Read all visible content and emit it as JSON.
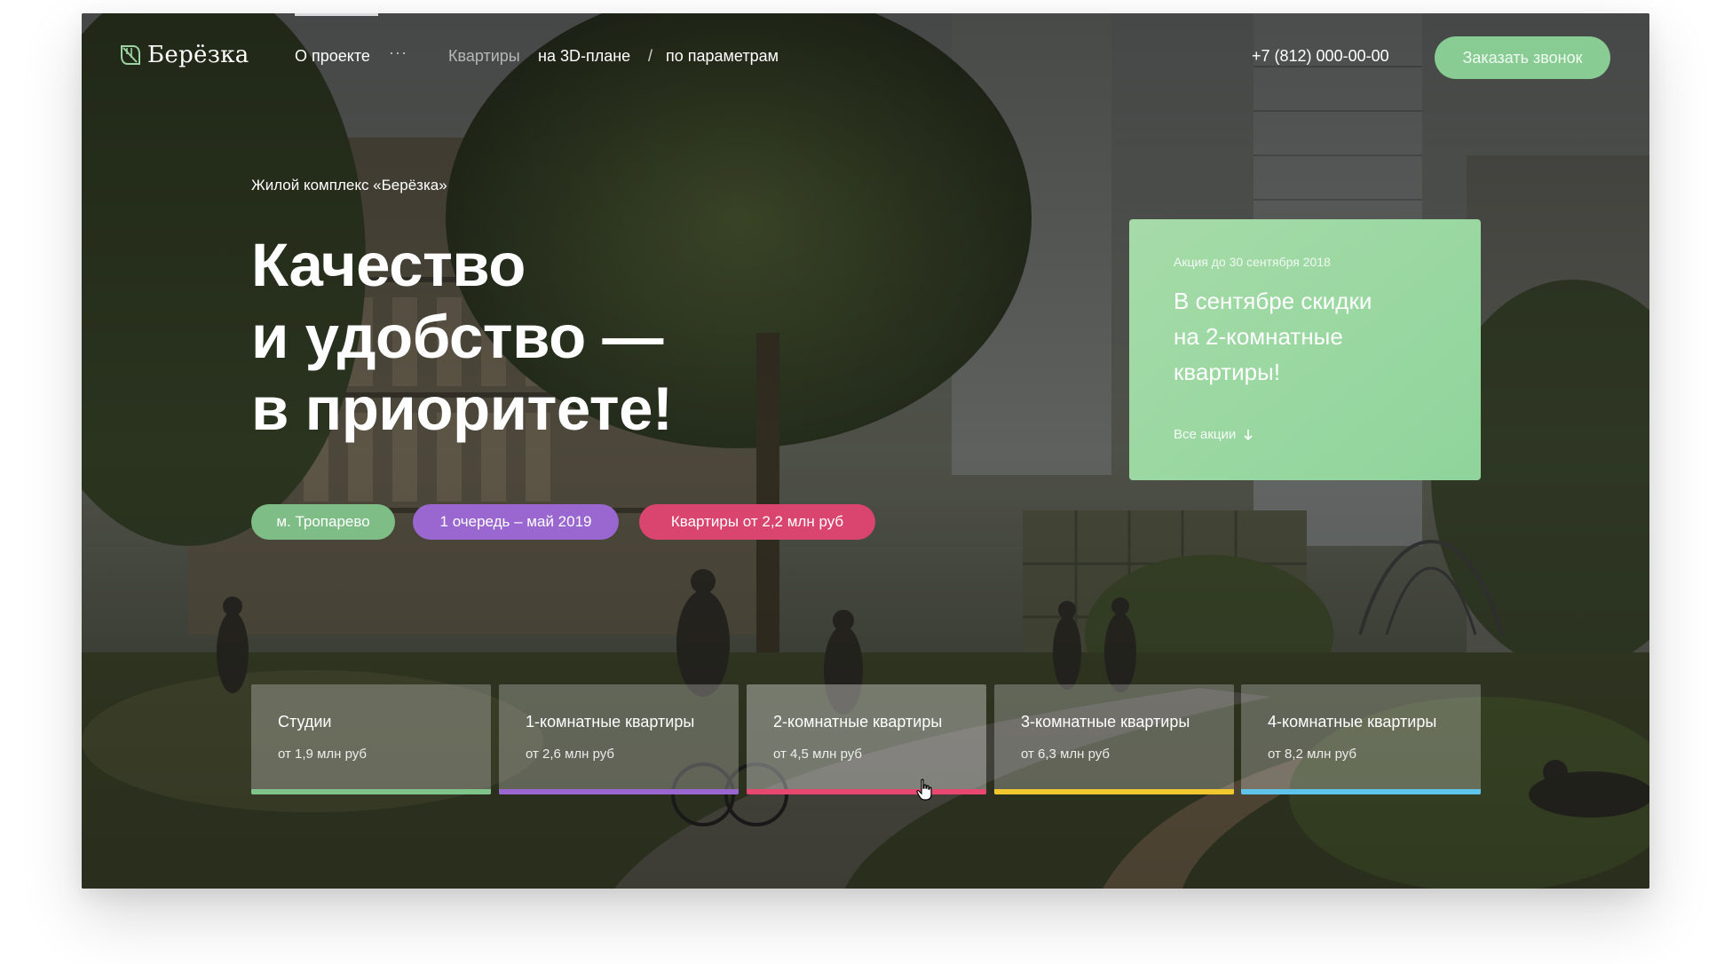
{
  "header": {
    "logo_text": "Берёзка",
    "logo_icon": "leaf-icon",
    "nav_about": "О проекте",
    "nav_more": "···",
    "nav_apartments": "Квартиры",
    "nav_3d": "на 3D-плане",
    "nav_separator": "/",
    "nav_params": "по параметрам",
    "phone": "+7 (812) 000-00-00",
    "callback_label": "Заказать звонок"
  },
  "hero": {
    "subtitle": "Жилой комплекс «Берёзка»",
    "headline_lines": [
      "Качество",
      "и удобство —",
      "в приоритете!"
    ],
    "chips": [
      {
        "label": "м. Тропарево",
        "color": "#7fbd86"
      },
      {
        "label": "1 очередь – май 2019",
        "color": "#9a66cf"
      },
      {
        "label": "Квартиры от 2,2 млн руб",
        "color": "#d9456f"
      }
    ]
  },
  "promo": {
    "date": "Акция до 30 сентября 2018",
    "title_lines": [
      "В сентябре скидки",
      "на 2-комнатные",
      "квартиры!"
    ],
    "link_label": "Все акции",
    "link_icon": "arrow-down-icon",
    "color": "#95d79f"
  },
  "apartments": [
    {
      "title": "Студии",
      "price": "от 1,9 млн руб",
      "color": "#7fc48a"
    },
    {
      "title": "1-комнатные квартиры",
      "price": "от 2,6 млн руб",
      "color": "#9a66cf"
    },
    {
      "title": "2-комнатные квартиры",
      "price": "от 4,5 млн руб",
      "color": "#e8476f"
    },
    {
      "title": "3-комнатные квартиры",
      "price": "от 6,3 млн руб",
      "color": "#f2c82f"
    },
    {
      "title": "4-комнатные квартиры",
      "price": "от 8,2 млн руб",
      "color": "#5fc4ea"
    }
  ]
}
